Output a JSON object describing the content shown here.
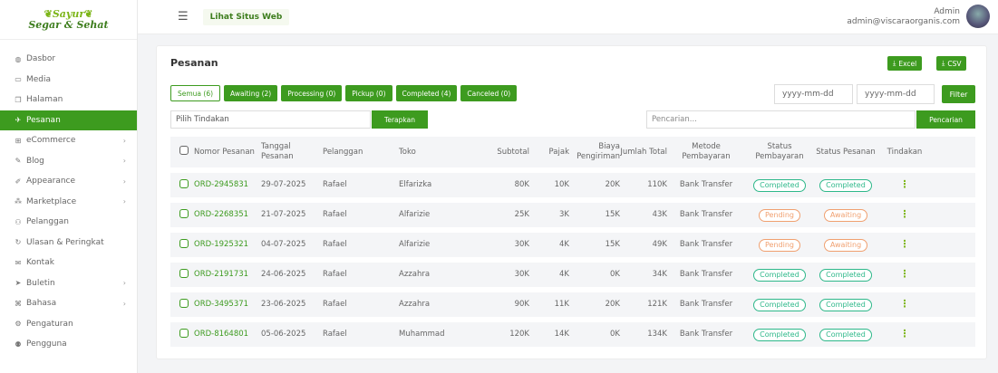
{
  "logo": {
    "line1": "Sayur",
    "line2": "Segar & Sehat"
  },
  "sidebar": {
    "items": [
      {
        "label": "Dasbor",
        "icon": "dashboard-icon",
        "glyph": "◍",
        "chevron": false,
        "active": false
      },
      {
        "label": "Media",
        "icon": "image-icon",
        "glyph": "▭",
        "chevron": false,
        "active": false
      },
      {
        "label": "Halaman",
        "icon": "pages-icon",
        "glyph": "❐",
        "chevron": false,
        "active": false
      },
      {
        "label": "Pesanan",
        "icon": "send-icon",
        "glyph": "✈",
        "chevron": false,
        "active": true
      },
      {
        "label": "eCommerce",
        "icon": "cart-icon",
        "glyph": "⊞",
        "chevron": true,
        "active": false
      },
      {
        "label": "Blog",
        "icon": "edit-icon",
        "glyph": "✎",
        "chevron": true,
        "active": false
      },
      {
        "label": "Appearance",
        "icon": "brush-icon",
        "glyph": "✐",
        "chevron": true,
        "active": false
      },
      {
        "label": "Marketplace",
        "icon": "marketplace-icon",
        "glyph": "⁂",
        "chevron": true,
        "active": false
      },
      {
        "label": "Pelanggan",
        "icon": "users-icon",
        "glyph": "⚇",
        "chevron": false,
        "active": false
      },
      {
        "label": "Ulasan & Peringkat",
        "icon": "refresh-icon",
        "glyph": "↻",
        "chevron": false,
        "active": false
      },
      {
        "label": "Kontak",
        "icon": "mail-icon",
        "glyph": "✉",
        "chevron": false,
        "active": false
      },
      {
        "label": "Buletin",
        "icon": "paper-plane-icon",
        "glyph": "➤",
        "chevron": true,
        "active": false
      },
      {
        "label": "Bahasa",
        "icon": "language-icon",
        "glyph": "⌘",
        "chevron": true,
        "active": false
      },
      {
        "label": "Pengaturan",
        "icon": "settings-icon",
        "glyph": "⚙",
        "chevron": false,
        "active": false
      },
      {
        "label": "Pengguna",
        "icon": "user-group-icon",
        "glyph": "⚉",
        "chevron": false,
        "active": false
      }
    ]
  },
  "topbar": {
    "site_link": "Lihat Situs Web",
    "admin_name": "Admin",
    "admin_email": "admin@viscaraorganis.com"
  },
  "page": {
    "title": "Pesanan",
    "export_excel": "Excel",
    "export_csv": "CSV",
    "filter_tabs": [
      {
        "label": "Semua (6)",
        "selected": true
      },
      {
        "label": "Awaiting (2)",
        "selected": false
      },
      {
        "label": "Processing (0)",
        "selected": false
      },
      {
        "label": "Pickup (0)",
        "selected": false
      },
      {
        "label": "Completed (4)",
        "selected": false
      },
      {
        "label": "Canceled (0)",
        "selected": false
      }
    ],
    "date_from_placeholder": "yyyy-mm-dd",
    "date_to_placeholder": "yyyy-mm-dd",
    "filter_button": "Filter",
    "action_select": "Pilih Tindakan",
    "apply_button": "Terapkan",
    "search_placeholder": "Pencarian...",
    "search_button": "Pencarian"
  },
  "table": {
    "headers": [
      "Nomor Pesanan",
      "Tanggal Pesanan",
      "Pelanggan",
      "Toko",
      "Subtotal",
      "Pajak",
      "Biaya Pengiriman",
      "Jumlah Total",
      "Metode Pembayaran",
      "Status Pembayaran",
      "Status Pesanan",
      "Tindakan"
    ],
    "rows": [
      {
        "order": "ORD-2945831",
        "date": "29-07-2025",
        "customer": "Rafael",
        "store": "Elfarizka",
        "subtotal": "80K",
        "tax": "10K",
        "shipping": "20K",
        "total": "110K",
        "method": "Bank Transfer",
        "pay_status": "Completed",
        "order_status": "Completed"
      },
      {
        "order": "ORD-2268351",
        "date": "21-07-2025",
        "customer": "Rafael",
        "store": "Alfarizie",
        "subtotal": "25K",
        "tax": "3K",
        "shipping": "15K",
        "total": "43K",
        "method": "Bank Transfer",
        "pay_status": "Pending",
        "order_status": "Awaiting"
      },
      {
        "order": "ORD-1925321",
        "date": "04-07-2025",
        "customer": "Rafael",
        "store": "Alfarizie",
        "subtotal": "30K",
        "tax": "4K",
        "shipping": "15K",
        "total": "49K",
        "method": "Bank Transfer",
        "pay_status": "Pending",
        "order_status": "Awaiting"
      },
      {
        "order": "ORD-2191731",
        "date": "24-06-2025",
        "customer": "Rafael",
        "store": "Azzahra",
        "subtotal": "30K",
        "tax": "4K",
        "shipping": "0K",
        "total": "34K",
        "method": "Bank Transfer",
        "pay_status": "Completed",
        "order_status": "Completed"
      },
      {
        "order": "ORD-3495371",
        "date": "23-06-2025",
        "customer": "Rafael",
        "store": "Azzahra",
        "subtotal": "90K",
        "tax": "11K",
        "shipping": "20K",
        "total": "121K",
        "method": "Bank Transfer",
        "pay_status": "Completed",
        "order_status": "Completed"
      },
      {
        "order": "ORD-8164801",
        "date": "05-06-2025",
        "customer": "Rafael",
        "store": "Muhammad",
        "subtotal": "120K",
        "tax": "14K",
        "shipping": "0K",
        "total": "134K",
        "method": "Bank Transfer",
        "pay_status": "Completed",
        "order_status": "Completed"
      }
    ]
  },
  "colors": {
    "accent": "#3d9b1f",
    "completed": "#2eb88a",
    "pending": "#f0a070"
  }
}
